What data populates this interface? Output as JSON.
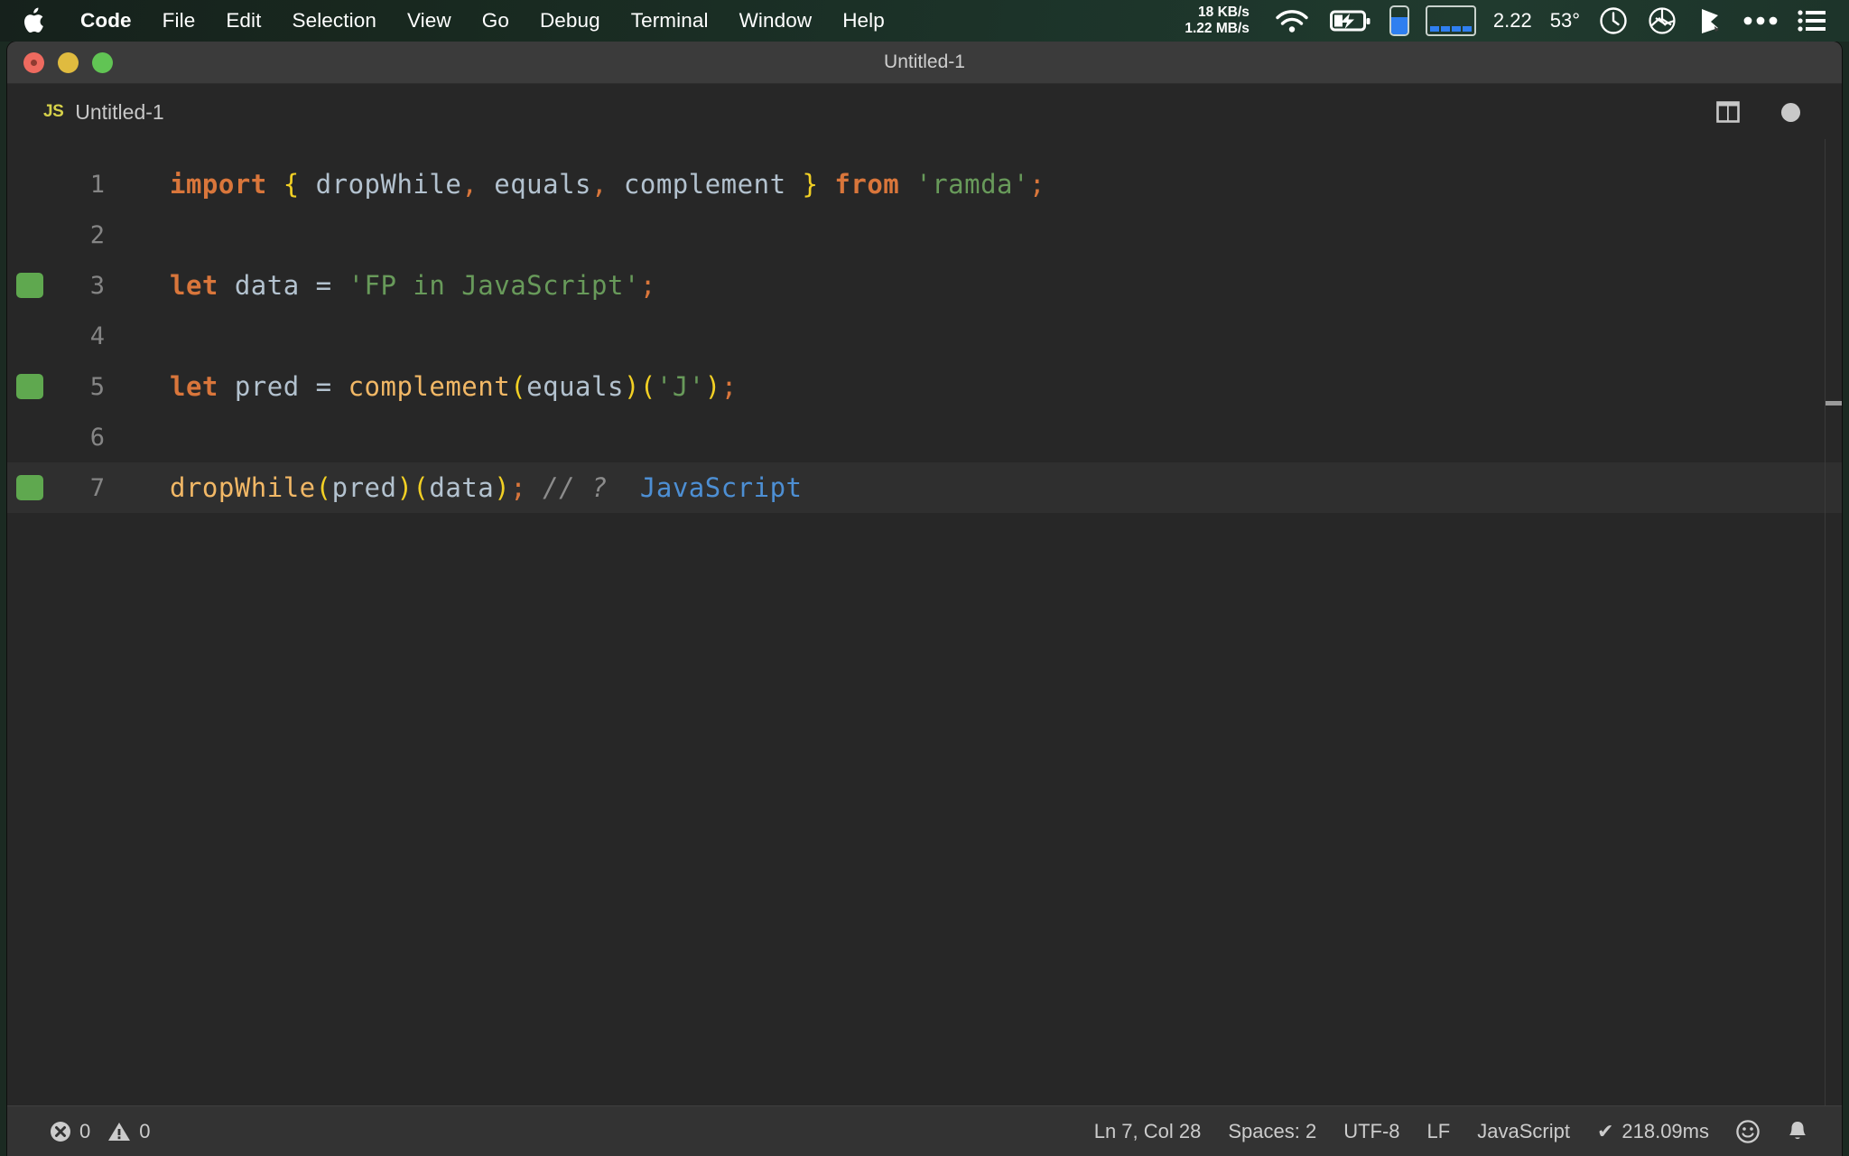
{
  "menubar": {
    "apple_icon": "apple-logo-icon",
    "items": [
      {
        "label": "Code",
        "bold": true
      },
      {
        "label": "File",
        "bold": false
      },
      {
        "label": "Edit",
        "bold": false
      },
      {
        "label": "Selection",
        "bold": false
      },
      {
        "label": "View",
        "bold": false
      },
      {
        "label": "Go",
        "bold": false
      },
      {
        "label": "Debug",
        "bold": false
      },
      {
        "label": "Terminal",
        "bold": false
      },
      {
        "label": "Window",
        "bold": false
      },
      {
        "label": "Help",
        "bold": false
      }
    ],
    "network": {
      "upload": "18 KB/s",
      "download": "1.22 MB/s"
    },
    "wifi_icon": "wifi-icon",
    "battery_icon": "battery-charging-icon",
    "battery_pill_icon": "battery-level-icon",
    "signal_bars_icon": "signal-bars-icon",
    "load_value": "2.22",
    "temperature": "53°",
    "clock_icon": "clock-icon",
    "aperture_icon": "aperture-icon",
    "dropbox_icon": "dropbox-icon",
    "overflow_icon": "ellipsis-icon",
    "control_center_icon": "list-menu-icon"
  },
  "window": {
    "title": "Untitled-1",
    "traffic": {
      "close": "close-button",
      "minimize": "minimize-button",
      "zoom": "zoom-button"
    }
  },
  "tab": {
    "language_badge": "JS",
    "label": "Untitled-1",
    "split_editor_icon": "split-editor-icon",
    "dirty_indicator": "unsaved-dot-icon"
  },
  "editor": {
    "lines": [
      {
        "number": "1",
        "covered": false,
        "active": false,
        "tokens": [
          {
            "t": "import",
            "c": "tk-keyword"
          },
          {
            "t": " ",
            "c": "tk-op"
          },
          {
            "t": "{",
            "c": "tk-brace"
          },
          {
            "t": " dropWhile",
            "c": "tk-var"
          },
          {
            "t": ",",
            "c": "tk-punc"
          },
          {
            "t": " equals",
            "c": "tk-var"
          },
          {
            "t": ",",
            "c": "tk-punc"
          },
          {
            "t": " complement ",
            "c": "tk-var"
          },
          {
            "t": "}",
            "c": "tk-brace"
          },
          {
            "t": " ",
            "c": "tk-op"
          },
          {
            "t": "from",
            "c": "tk-keyword"
          },
          {
            "t": " ",
            "c": "tk-op"
          },
          {
            "t": "'ramda'",
            "c": "tk-string"
          },
          {
            "t": ";",
            "c": "tk-punc"
          }
        ]
      },
      {
        "number": "2",
        "covered": false,
        "active": false,
        "tokens": []
      },
      {
        "number": "3",
        "covered": true,
        "active": false,
        "tokens": [
          {
            "t": "let",
            "c": "tk-keyword"
          },
          {
            "t": " data ",
            "c": "tk-var"
          },
          {
            "t": "=",
            "c": "tk-op"
          },
          {
            "t": " ",
            "c": "tk-op"
          },
          {
            "t": "'FP in JavaScript'",
            "c": "tk-string"
          },
          {
            "t": ";",
            "c": "tk-punc"
          }
        ]
      },
      {
        "number": "4",
        "covered": false,
        "active": false,
        "tokens": []
      },
      {
        "number": "5",
        "covered": true,
        "active": false,
        "tokens": [
          {
            "t": "let",
            "c": "tk-keyword"
          },
          {
            "t": " pred ",
            "c": "tk-var"
          },
          {
            "t": "=",
            "c": "tk-op"
          },
          {
            "t": " ",
            "c": "tk-op"
          },
          {
            "t": "complement",
            "c": "tk-func"
          },
          {
            "t": "(",
            "c": "tk-paren"
          },
          {
            "t": "equals",
            "c": "tk-var"
          },
          {
            "t": ")",
            "c": "tk-paren"
          },
          {
            "t": "(",
            "c": "tk-paren"
          },
          {
            "t": "'J'",
            "c": "tk-string"
          },
          {
            "t": ")",
            "c": "tk-paren"
          },
          {
            "t": ";",
            "c": "tk-punc"
          }
        ]
      },
      {
        "number": "6",
        "covered": false,
        "active": false,
        "tokens": []
      },
      {
        "number": "7",
        "covered": true,
        "active": true,
        "tokens": [
          {
            "t": "dropWhile",
            "c": "tk-func"
          },
          {
            "t": "(",
            "c": "tk-paren"
          },
          {
            "t": "pred",
            "c": "tk-var"
          },
          {
            "t": ")",
            "c": "tk-paren"
          },
          {
            "t": "(",
            "c": "tk-paren"
          },
          {
            "t": "data",
            "c": "tk-var"
          },
          {
            "t": ")",
            "c": "tk-paren"
          },
          {
            "t": ";",
            "c": "tk-punc"
          },
          {
            "t": " ",
            "c": "tk-op"
          },
          {
            "t": "// ?",
            "c": "tk-comment"
          },
          {
            "t": "  ",
            "c": "tk-op"
          },
          {
            "t": "JavaScript",
            "c": "tk-result"
          }
        ]
      }
    ]
  },
  "statusbar": {
    "error_icon": "error-circle-icon",
    "error_count": "0",
    "warning_icon": "warning-triangle-icon",
    "warning_count": "0",
    "cursor_position": "Ln 7, Col 28",
    "indentation": "Spaces: 2",
    "encoding": "UTF-8",
    "eol": "LF",
    "language": "JavaScript",
    "quokka_check": "✔",
    "quokka_time": "218.09ms",
    "feedback_icon": "smiley-icon",
    "notifications_icon": "bell-icon"
  },
  "colors": {
    "accent_green": "#5fa84f",
    "keyword_orange": "#d9763b",
    "string_green": "#689a5a",
    "function_tan": "#f2b866",
    "brace_yellow": "#f2d024",
    "result_blue": "#4d8fd4",
    "editor_bg": "#272727",
    "statusbar_bg": "#333333",
    "titlebar_bg": "#3b3b3b"
  }
}
